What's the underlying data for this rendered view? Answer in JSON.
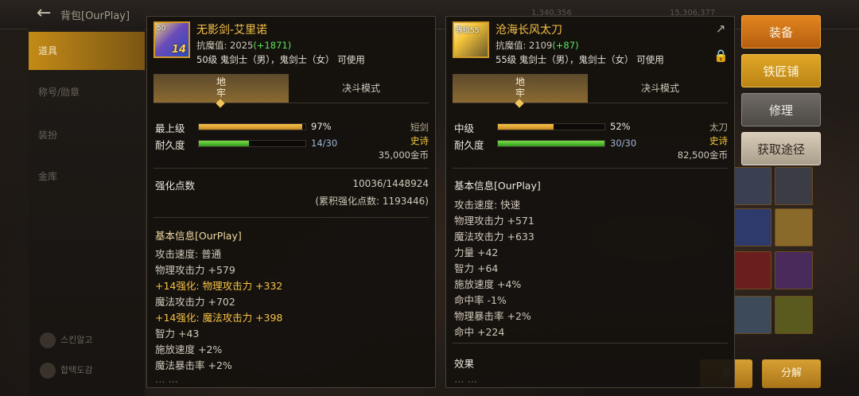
{
  "window": {
    "title": "背包[OurPlay]",
    "left_menu": [
      "道具",
      "称号/勋章",
      "装扮",
      "金库"
    ],
    "bottom_left": [
      "스킨알고",
      "합택도감"
    ],
    "side_buttons": {
      "equip": "装备",
      "smith": "铁匠铺",
      "repair": "修理",
      "source": "获取途径"
    },
    "bottom_buttons": {
      "sell": "卖",
      "decompose": "分解"
    },
    "topbar_faint": [
      "1,340,356",
      "15,306,377"
    ]
  },
  "left_item": {
    "level_tag": "50",
    "enhance_tag": "14",
    "name": "无影剑-艾里诺",
    "resist_label": "抗魔值:",
    "resist_value": "2025",
    "resist_bonus": "(+1871)",
    "usable": "50级 鬼剑士（男），鬼剑士（女） 可使用",
    "tabs": [
      "地牢",
      "决斗模式"
    ],
    "grade_label": "最上级",
    "grade_value": "97%",
    "grade_percent": 97,
    "durability_label": "耐久度",
    "durability_value": "14/30",
    "durability_fraction": 0.4667,
    "weapon_type": "短剑",
    "rarity": "史诗",
    "price": "35,000金币",
    "enhance_label": "强化点数",
    "enhance_value": "10036/1448924",
    "enhance_accum": "(累积强化点数: 1193446)",
    "basic_title": "基本信息[OurPlay]",
    "lines": [
      {
        "text": "攻击速度:  普通",
        "enh": false
      },
      {
        "text": "物理攻击力 +579",
        "enh": false
      },
      {
        "text": "+14强化:  物理攻击力 +332",
        "enh": true
      },
      {
        "text": "魔法攻击力 +702",
        "enh": false
      },
      {
        "text": "+14强化:  魔法攻击力 +398",
        "enh": true
      },
      {
        "text": "智力 +43",
        "enh": false
      },
      {
        "text": "施放速度 +2%",
        "enh": false
      },
      {
        "text": "魔法暴击率 +2%",
        "enh": false
      }
    ]
  },
  "right_item": {
    "level_tag": "等级55",
    "name": "沧海长风太刀",
    "resist_label": "抗魔值:",
    "resist_value": "2109",
    "resist_bonus": "(+87)",
    "usable": "55级 鬼剑士（男），鬼剑士（女） 可使用",
    "tabs": [
      "地牢",
      "决斗模式"
    ],
    "grade_label": "中级",
    "grade_value": "52%",
    "grade_percent": 52,
    "durability_label": "耐久度",
    "durability_value": "30/30",
    "durability_fraction": 1.0,
    "weapon_type": "太刀",
    "rarity": "史诗",
    "price": "82,500金币",
    "basic_title": "基本信息[OurPlay]",
    "lines": [
      {
        "text": "攻击速度:  快速",
        "enh": false
      },
      {
        "text": "物理攻击力 +571",
        "enh": false
      },
      {
        "text": "魔法攻击力 +633",
        "enh": false
      },
      {
        "text": "力量 +42",
        "enh": false
      },
      {
        "text": "智力 +64",
        "enh": false
      },
      {
        "text": "施放速度 +4%",
        "enh": false
      },
      {
        "text": "命中率 -1%",
        "enh": false
      },
      {
        "text": "物理暴击率 +2%",
        "enh": false
      },
      {
        "text": "命中 +224",
        "enh": false
      }
    ],
    "effect_title": "效果"
  },
  "colors": {
    "accent_gold": "#f6c146",
    "resist_green": "#5ee35e",
    "equip_orange": "#e1861f"
  }
}
